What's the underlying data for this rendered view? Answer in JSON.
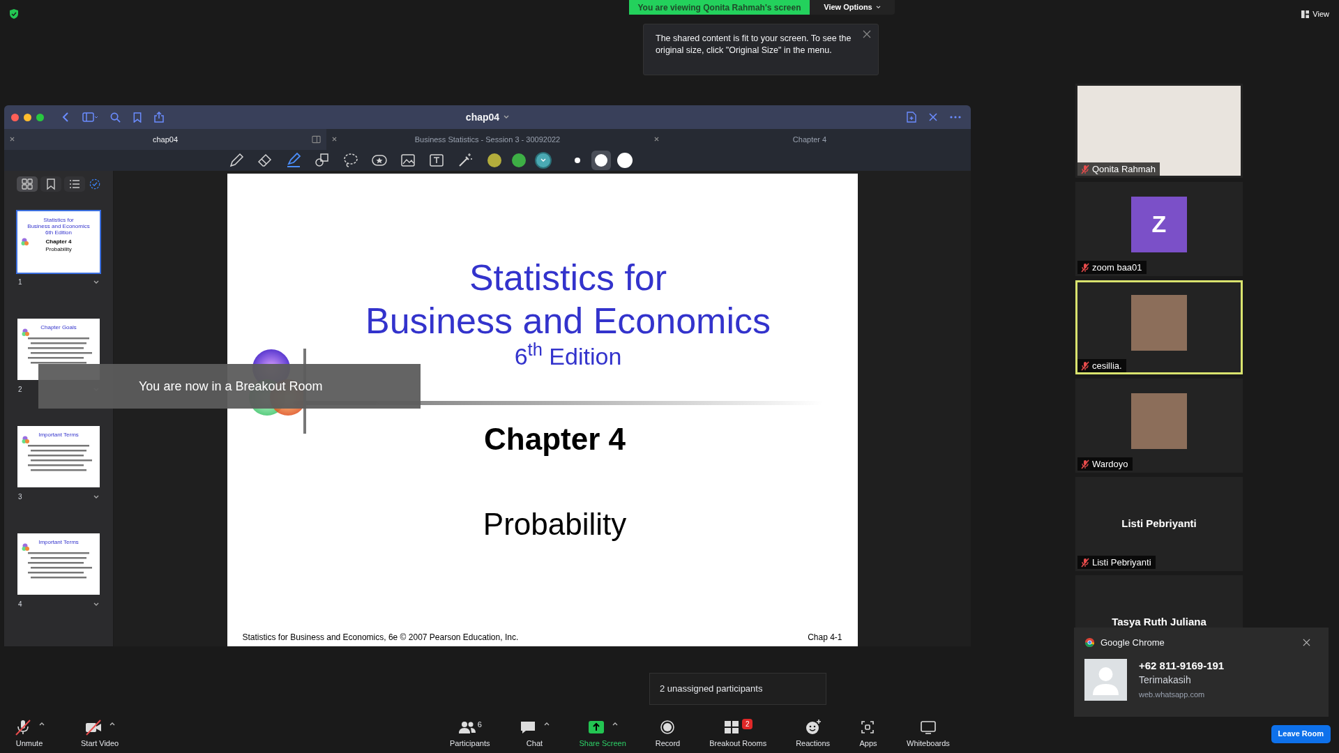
{
  "share_banner": {
    "text": "You are viewing Qonita Rahmah's screen",
    "menu": "View Options"
  },
  "fit_tooltip": {
    "text": "The shared content is fit to your screen. To see the original size, click \"Original Size\" in the menu."
  },
  "view_button": "View",
  "shared_window": {
    "title": "chap04",
    "tabs": [
      {
        "label": "chap04",
        "selected": true
      },
      {
        "label": "Business Statistics - Session 3 - 30092022",
        "selected": false
      },
      {
        "label": "Chapter 4",
        "selected": false
      }
    ],
    "tools": [
      {
        "kind": "pen",
        "selected": false
      },
      {
        "kind": "eraser",
        "selected": false
      },
      {
        "kind": "highlighter",
        "selected": true
      },
      {
        "kind": "shapes",
        "selected": false
      },
      {
        "kind": "lasso",
        "selected": false
      },
      {
        "kind": "sticker",
        "selected": false
      },
      {
        "kind": "image",
        "selected": false
      },
      {
        "kind": "textbox",
        "selected": false
      },
      {
        "kind": "wand",
        "selected": false
      }
    ],
    "swatches": [
      {
        "color": "#b3ad3c",
        "selected": false
      },
      {
        "color": "#3daf45",
        "selected": false
      },
      {
        "color": "#4aa9b3",
        "selected": true
      }
    ],
    "stroke_sizes": [
      {
        "kind": "small",
        "selected": false
      },
      {
        "kind": "medium",
        "selected": true
      },
      {
        "kind": "large",
        "selected": false
      }
    ],
    "sidebar_views": [
      {
        "kind": "grid",
        "selected": true
      },
      {
        "kind": "bookmark",
        "selected": false
      },
      {
        "kind": "outline",
        "selected": false
      }
    ],
    "thumbnails": [
      {
        "kind": "title",
        "number": "1",
        "selected": true,
        "lines": [
          "Statistics for",
          "Business and Economics",
          "6th Edition",
          "Chapter 4",
          "Probability"
        ]
      },
      {
        "kind": "content",
        "number": "2",
        "selected": false,
        "title": "Chapter Goals"
      },
      {
        "kind": "content",
        "number": "3",
        "selected": false,
        "title": "Important Terms"
      },
      {
        "kind": "content",
        "number": "4",
        "selected": false,
        "title": "Important Terms"
      }
    ],
    "slide": {
      "title_lines": [
        "Statistics for",
        "Business and Economics"
      ],
      "edition": "6$^{th}$ Edition",
      "chapter": "Chapter 4",
      "subtitle": "Probability",
      "footer_left": "Statistics for Business and Economics, 6e © 2007 Pearson Education, Inc.",
      "footer_right": "Chap 4-1"
    }
  },
  "breakout_toast": "You are now in a Breakout Room",
  "gallery": [
    {
      "kind": "video",
      "name": "Qonita Rahmah",
      "muted": true,
      "active": false
    },
    {
      "kind": "letter",
      "letter": "Z",
      "name": "zoom baa01",
      "muted": true,
      "active": false
    },
    {
      "kind": "photo",
      "name": "cesillia.",
      "muted": true,
      "active": true
    },
    {
      "kind": "photo",
      "name": "Wardoyo",
      "muted": true,
      "active": false
    },
    {
      "kind": "text",
      "display": "Listi Pebriyanti",
      "name": "Listi Pebriyanti",
      "muted": true,
      "active": false
    },
    {
      "kind": "text",
      "display": "Tasya Ruth Juliana",
      "active": false
    }
  ],
  "unassigned_popup": "2 unassigned participants",
  "toolbar": {
    "items": [
      {
        "kind": "audio",
        "label": "Unmute",
        "muted": true,
        "caret": true
      },
      {
        "kind": "video",
        "label": "Start Video",
        "muted": true,
        "caret": true
      },
      {
        "kind": "participants",
        "label": "Participants",
        "count": "6",
        "caret": false
      },
      {
        "kind": "chat",
        "label": "Chat",
        "caret": true
      },
      {
        "kind": "share",
        "label": "Share Screen",
        "caret": true
      },
      {
        "kind": "record",
        "label": "Record",
        "caret": false
      },
      {
        "kind": "breakout",
        "label": "Breakout Rooms",
        "badge": "2",
        "caret": false
      },
      {
        "kind": "reactions",
        "label": "Reactions",
        "caret": false
      },
      {
        "kind": "apps",
        "label": "Apps",
        "caret": false
      },
      {
        "kind": "whiteboards",
        "label": "Whiteboards",
        "caret": false
      }
    ],
    "leave": "Leave Room"
  },
  "notification": {
    "app": "Google Chrome",
    "sender": "+62 811-9169-191",
    "message": "Terimakasih",
    "source": "web.whatsapp.com"
  }
}
